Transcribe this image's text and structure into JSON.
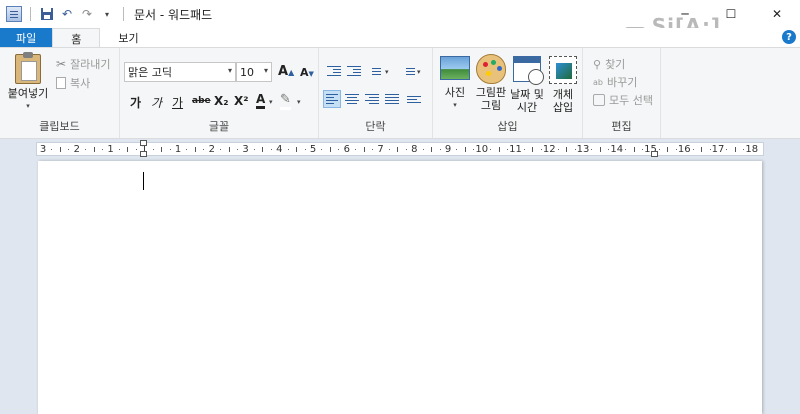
{
  "window": {
    "title": "문서 - 워드패드",
    "controls": {
      "minimize": "─",
      "maximize": "☐",
      "close": "✕"
    }
  },
  "watermark": {
    "text": "Si[A:] DRIVE"
  },
  "tabs": [
    {
      "label": "파일"
    },
    {
      "label": "홈"
    },
    {
      "label": "보기"
    }
  ],
  "help_label": "?",
  "ribbon": {
    "clipboard": {
      "label": "클립보드",
      "paste": "붙여넣기",
      "cut": "잘라내기",
      "copy": "복사"
    },
    "font": {
      "label": "글꼴",
      "font_name": "맑은 고딕",
      "font_size": "10",
      "bold": "가",
      "italic": "가",
      "underline": "가",
      "strike": "abe",
      "subscript": "X₂",
      "superscript": "X²",
      "grow": "A",
      "shrink": "A",
      "color": "A"
    },
    "paragraph": {
      "label": "단락"
    },
    "insert": {
      "label": "삽입",
      "picture": "사진",
      "paint_line1": "그림판",
      "paint_line2": "그림",
      "datetime_line1": "날짜 및",
      "datetime_line2": "시간",
      "object_line1": "개체",
      "object_line2": "삽입"
    },
    "editing": {
      "label": "편집",
      "find": "찾기",
      "replace": "바꾸기",
      "select_all": "모두 선택"
    }
  },
  "ruler": {
    "labels": [
      "3",
      "2",
      "1",
      "1",
      "1",
      "2",
      "3",
      "4",
      "5",
      "6",
      "7",
      "8",
      "9",
      "10",
      "11",
      "12",
      "13",
      "14",
      "15",
      "16",
      "17",
      "18"
    ]
  }
}
